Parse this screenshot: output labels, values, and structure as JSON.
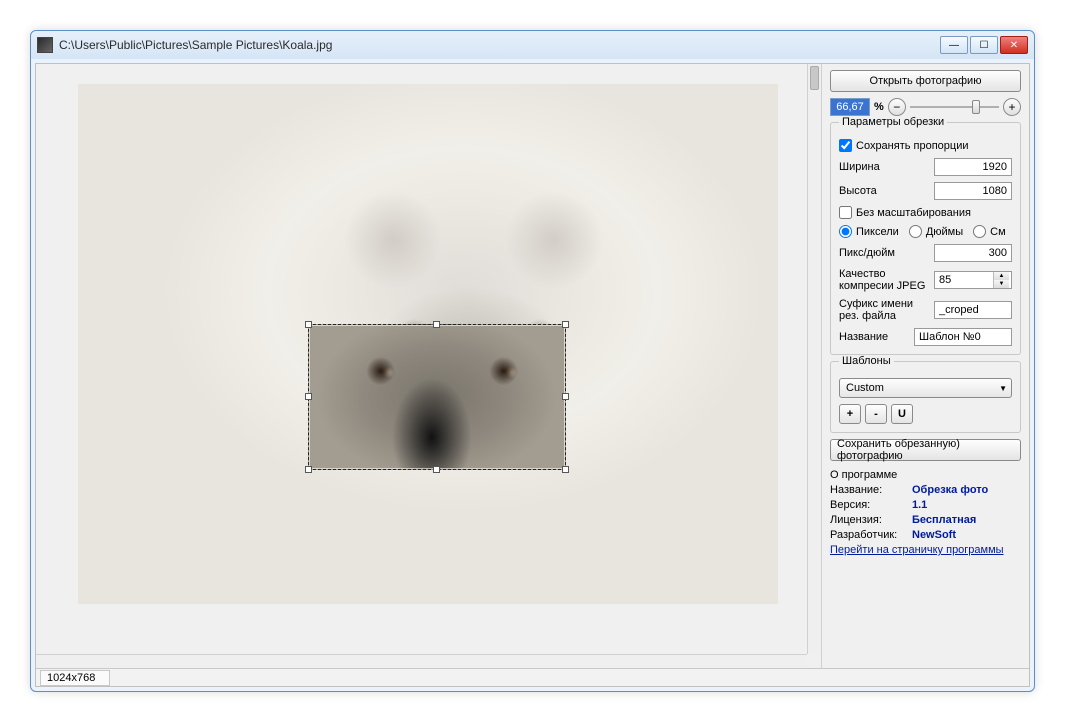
{
  "title_path": "C:\\Users\\Public\\Pictures\\Sample Pictures\\Koala.jpg",
  "btn_open": "Открыть фотографию",
  "zoom_value": "66,67",
  "zoom_pct": "%",
  "crop_params": {
    "title": "Параметры обрезки",
    "keep_aspect": "Сохранять пропорции",
    "width_label": "Ширина",
    "width_value": "1920",
    "height_label": "Высота",
    "height_value": "1080",
    "no_scale": "Без масштабирования",
    "unit_px": "Пиксели",
    "unit_in": "Дюймы",
    "unit_cm": "См",
    "ppi_label": "Пикс/дюйм",
    "ppi_value": "300",
    "jpeg_label": "Качество\nкомпресии JPEG",
    "jpeg_value": "85",
    "suffix_label": "Суфикс имени\nрез. файла",
    "suffix_value": "_croped",
    "name_label": "Название",
    "name_value": "Шаблон №0"
  },
  "templates": {
    "title": "Шаблоны",
    "selected": "Custom",
    "add": "+",
    "remove": "-",
    "update": "U"
  },
  "btn_save": "Сохранить обрезанную) фотографию",
  "about": {
    "title": "О программе",
    "name_k": "Название:",
    "name_v": "Обрезка фото",
    "ver_k": "Версия:",
    "ver_v": "1.1",
    "lic_k": "Лицензия:",
    "lic_v": "Бесплатная",
    "dev_k": "Разработчик:",
    "dev_v": "NewSoft",
    "link": "Перейти на страничку программы"
  },
  "status_dim": "1024x768"
}
